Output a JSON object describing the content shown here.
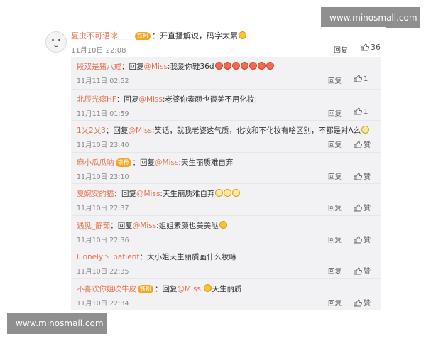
{
  "watermarks": {
    "top": "www.minosmall.com",
    "bottom": "www.minosmall.com"
  },
  "main_comment": {
    "user": "夏虫不可语冰____",
    "badge": "铁粉",
    "text": "：开直播解说，码字太累",
    "time": "11月10日 22:08",
    "reply_label": "回复",
    "likes": "36"
  },
  "replies": [
    {
      "user": "段双是猪八戒",
      "badge": "",
      "prefix": "：回复",
      "mention": "@Miss",
      "text": ":我爱你鞋36d",
      "emojis": [
        "love",
        "love",
        "love",
        "love",
        "love",
        "love",
        "love"
      ],
      "time": "11月11日 02:52",
      "reply_label": "回复",
      "likes": "1"
    },
    {
      "user": "北辰光瘪HF",
      "badge": "",
      "prefix": "：回复",
      "mention": "@Miss",
      "text": ":老婆你素颜也很美不用化妆!",
      "emojis": [],
      "time": "11月11日 01:59",
      "reply_label": "回复",
      "likes": "1"
    },
    {
      "user": "1乂2乂3",
      "badge": "",
      "prefix": "：回复",
      "mention": "@Miss",
      "text": ":笑话，就我老婆这气质，化妆和不化妆有啥区别，不都是对A么",
      "emojis": [
        "glass"
      ],
      "time": "11月10日 23:40",
      "reply_label": "回复",
      "likes": "赞"
    },
    {
      "user": "麻小瓜瓜呐",
      "badge": "铁粉",
      "prefix": "：回复",
      "mention": "@Miss",
      "text": ":天生丽质难自弃",
      "emojis": [],
      "time": "11月10日 23:10",
      "reply_label": "回复",
      "likes": "赞"
    },
    {
      "user": "夏婉安的猫",
      "badge": "",
      "prefix": "：回复",
      "mention": "@Miss",
      "text": ":天生丽质难自弃",
      "emojis": [
        "glass",
        "glass",
        "glass"
      ],
      "time": "11月10日 22:37",
      "reply_label": "回复",
      "likes": "赞"
    },
    {
      "user": "遇见_静茹",
      "badge": "",
      "prefix": "：回复",
      "mention": "@Miss",
      "text": ":姐姐素颜也美美哒",
      "emojis": [
        "smile"
      ],
      "time": "11月10日 22:36",
      "reply_label": "回复",
      "likes": "赞"
    },
    {
      "user": "lLonely丶 patient",
      "badge": "",
      "prefix": "：",
      "mention": "",
      "text": "大小姐天生丽质画什么妆嘛",
      "emojis": [],
      "time": "11月10日 22:35",
      "reply_label": "回复",
      "likes": "赞"
    },
    {
      "user": "不喜欢你姐吹牛皮",
      "badge": "铁粉",
      "prefix": "：回复",
      "mention": "@Miss",
      "text": ":",
      "emojis": [
        "smile"
      ],
      "text2": "天生丽质",
      "time": "11月10日 22:34",
      "reply_label": "回复",
      "likes": "赞"
    }
  ],
  "colors": {
    "username": "#eb7350",
    "reply_bg": "#f2f2f5",
    "watermark_bg": "#8f8f8f"
  },
  "icons": {
    "like": "thumbs-up-icon",
    "avatar": "cartoon-face-avatar"
  }
}
